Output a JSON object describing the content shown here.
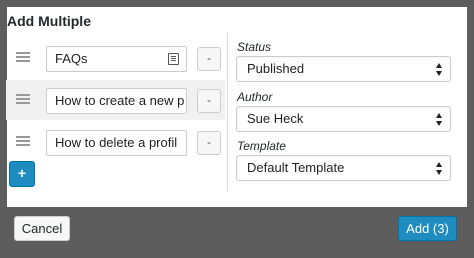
{
  "dialog": {
    "title": "Add Multiple"
  },
  "rows": [
    {
      "title": "FAQs",
      "remove_label": "-"
    },
    {
      "title": "How to create a new p",
      "remove_label": "-"
    },
    {
      "title": "How to delete a profil",
      "remove_label": "-"
    }
  ],
  "add_row_label": "+",
  "fields": {
    "status": {
      "label": "Status",
      "value": "Published"
    },
    "author": {
      "label": "Author",
      "value": "Sue Heck"
    },
    "template": {
      "label": "Template",
      "value": "Default Template"
    }
  },
  "footer": {
    "cancel_label": "Cancel",
    "submit_label": "Add (3)"
  },
  "colors": {
    "accent": "#1e8cbe",
    "frame": "#5d5d5d",
    "alt_row": "#f1f1f1"
  }
}
